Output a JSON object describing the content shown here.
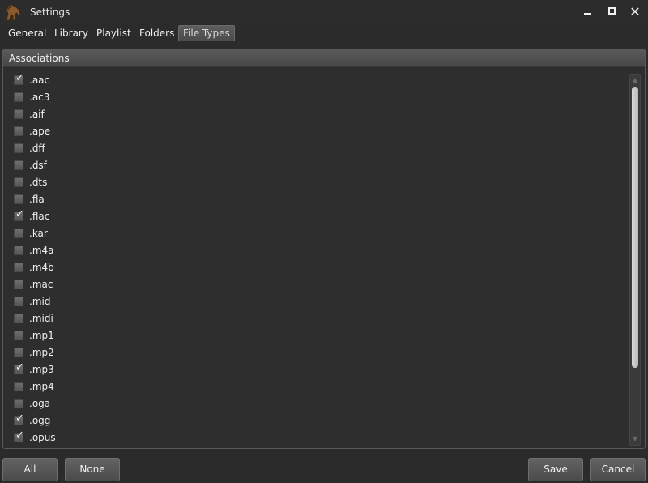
{
  "window": {
    "title": "Settings",
    "minimize_glyph": "",
    "maximize_glyph": "",
    "close_glyph": "✕"
  },
  "tabs": [
    {
      "label": "General"
    },
    {
      "label": "Library"
    },
    {
      "label": "Playlist"
    },
    {
      "label": "Folders"
    },
    {
      "label": "File Types",
      "active": true
    }
  ],
  "panel": {
    "header": "Associations",
    "items": [
      {
        "ext": ".aac",
        "checked": true
      },
      {
        "ext": ".ac3",
        "checked": false
      },
      {
        "ext": ".aif",
        "checked": false
      },
      {
        "ext": ".ape",
        "checked": false
      },
      {
        "ext": ".dff",
        "checked": false
      },
      {
        "ext": ".dsf",
        "checked": false
      },
      {
        "ext": ".dts",
        "checked": false
      },
      {
        "ext": ".fla",
        "checked": false
      },
      {
        "ext": ".flac",
        "checked": true
      },
      {
        "ext": ".kar",
        "checked": false
      },
      {
        "ext": ".m4a",
        "checked": false
      },
      {
        "ext": ".m4b",
        "checked": false
      },
      {
        "ext": ".mac",
        "checked": false
      },
      {
        "ext": ".mid",
        "checked": false
      },
      {
        "ext": ".midi",
        "checked": false
      },
      {
        "ext": ".mp1",
        "checked": false
      },
      {
        "ext": ".mp2",
        "checked": false
      },
      {
        "ext": ".mp3",
        "checked": true
      },
      {
        "ext": ".mp4",
        "checked": false
      },
      {
        "ext": ".oga",
        "checked": false
      },
      {
        "ext": ".ogg",
        "checked": true
      },
      {
        "ext": ".opus",
        "checked": true
      }
    ],
    "scroll_fraction_visible": 0.78
  },
  "buttons": {
    "all": "All",
    "none": "None",
    "save": "Save",
    "cancel": "Cancel"
  },
  "icons": {
    "app": "horse-app-icon",
    "check": "✓",
    "scroll_up": "▲",
    "scroll_down": "▼"
  },
  "colors": {
    "background": "#2b2b2b",
    "panel_header": "#4f4f4f",
    "text": "#f0f0f0"
  }
}
